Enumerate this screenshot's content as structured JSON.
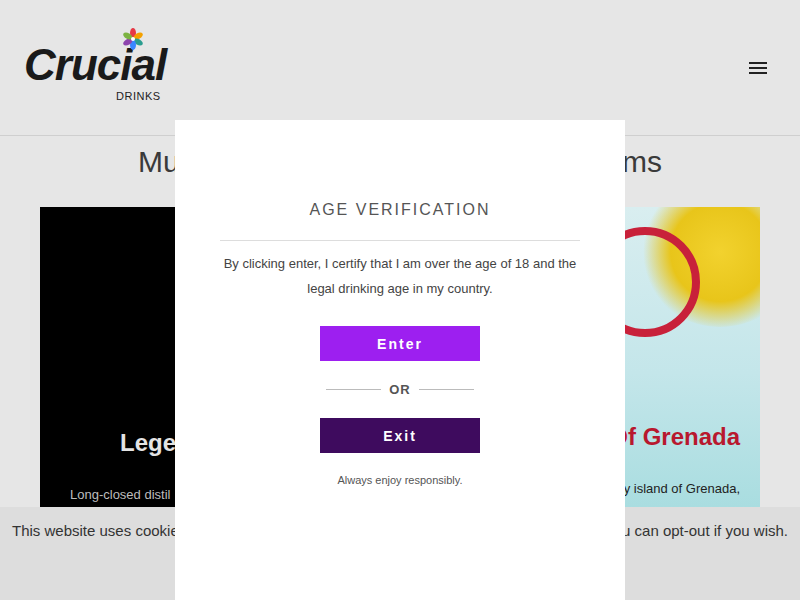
{
  "header": {
    "logo": "Crucial",
    "logo_sub": "DRINKS"
  },
  "heading": {
    "left": "Mu",
    "right": "ms"
  },
  "cards": [
    {
      "kind": "dark",
      "title": "Lege",
      "text": "Long-closed distil"
    },
    {
      "kind": "photo",
      "title": "Of Grenada",
      "text": "y island of Grenada,"
    }
  ],
  "cookie_bar": {
    "left": "This website uses cookie",
    "right": "u can opt-out if you wish."
  },
  "modal": {
    "title": "AGE VERIFICATION",
    "message": "By clicking enter, I certify that I am over the age of 18 and the legal drinking age in my country.",
    "enter": "Enter",
    "or": "OR",
    "exit": "Exit",
    "note": "Always enjoy responsibly."
  }
}
